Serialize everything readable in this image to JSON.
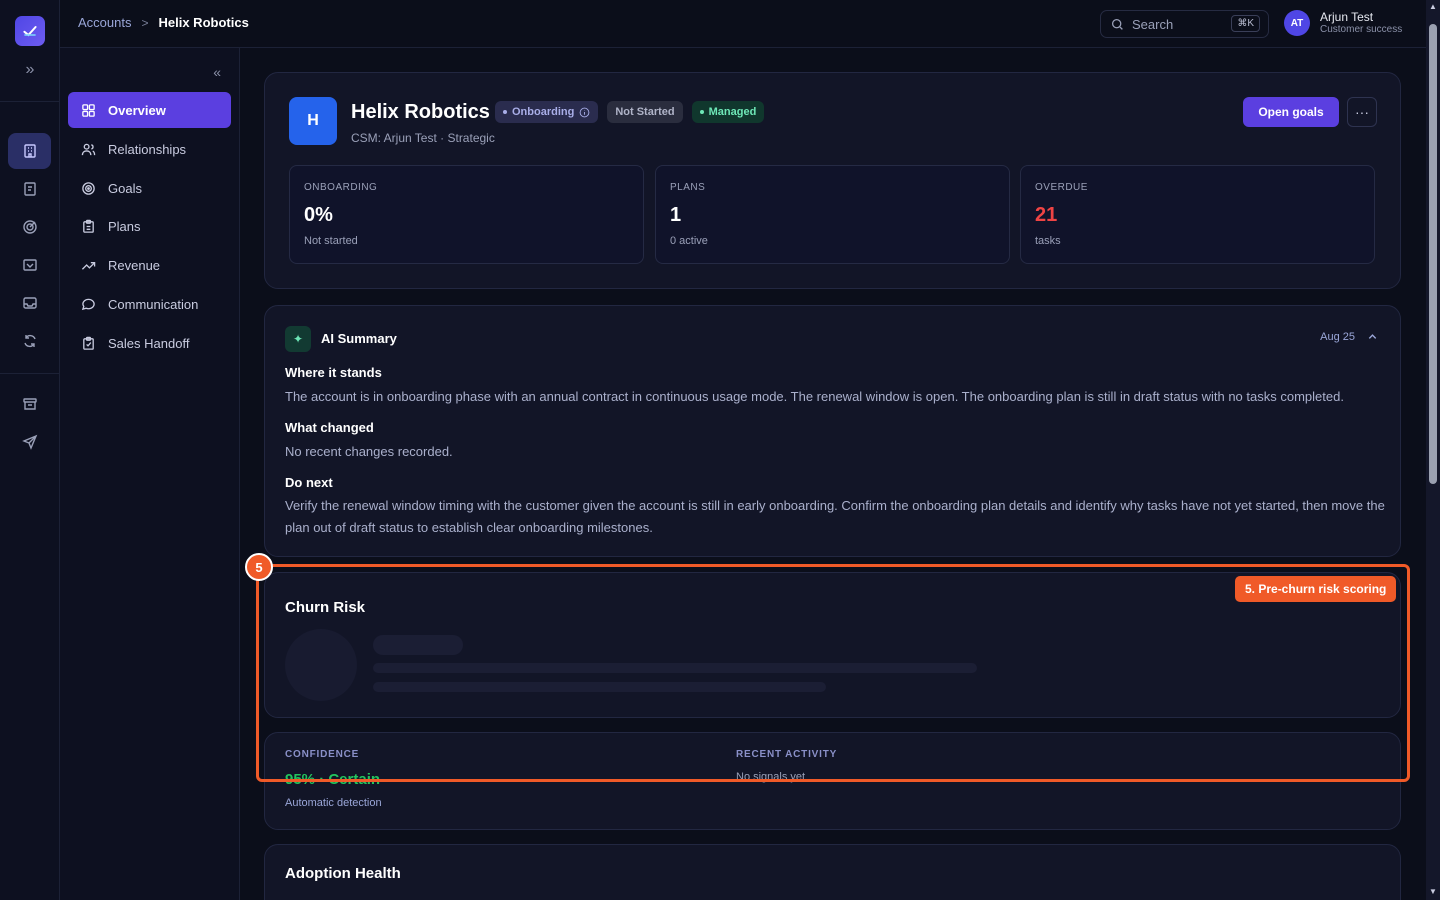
{
  "app": {
    "logo_icon": "check-logo-icon"
  },
  "breadcrumb": {
    "parent": "Accounts",
    "separator": ">",
    "current": "Helix Robotics"
  },
  "search": {
    "placeholder": "Search",
    "shortcut": "⌘K"
  },
  "user": {
    "initials": "AT",
    "name": "Arjun Test",
    "role": "Customer success"
  },
  "rail": {
    "icons": [
      "building-icon",
      "clipboard-icon",
      "target-icon",
      "handshake-icon",
      "inbox-icon",
      "refresh-icon",
      "archive-icon",
      "send-icon"
    ],
    "active": "building-icon"
  },
  "sidebar": {
    "items": [
      {
        "label": "Overview",
        "icon": "grid-icon",
        "active": true
      },
      {
        "label": "Relationships",
        "icon": "users-icon"
      },
      {
        "label": "Goals",
        "icon": "target-icon"
      },
      {
        "label": "Plans",
        "icon": "clipboard-icon"
      },
      {
        "label": "Revenue",
        "icon": "trend-up-icon"
      },
      {
        "label": "Communication",
        "icon": "chat-icon"
      },
      {
        "label": "Sales Handoff",
        "icon": "clipboard-check-icon"
      }
    ]
  },
  "account": {
    "initial": "H",
    "name": "Helix Robotics",
    "badges": {
      "phase": "Onboarding",
      "status": "Not Started",
      "type": "Managed"
    },
    "subtitle": "CSM: Arjun Test · Strategic",
    "primary_action": "Open goals",
    "more": "···"
  },
  "stats": [
    {
      "label": "ONBOARDING",
      "value": "0%",
      "sub": "Not started"
    },
    {
      "label": "PLANS",
      "value": "1",
      "sub": "0 active"
    },
    {
      "label": "OVERDUE",
      "value": "21",
      "sub": "tasks",
      "color": "#ef4444"
    }
  ],
  "ai_summary": {
    "title": "AI Summary",
    "date": "Aug 25",
    "sections": [
      {
        "heading": "Where it stands",
        "text": "The account is in onboarding phase with an annual contract in continuous usage mode. The renewal window is open. The onboarding plan is still in draft status with no tasks completed."
      },
      {
        "heading": "What changed",
        "text": "No recent changes recorded."
      },
      {
        "heading": "Do next",
        "text": "Verify the renewal window timing with the customer given the account is still in early onboarding. Confirm the onboarding plan details and identify why tasks have not yet started, then move the plan out of draft status to establish clear onboarding milestones."
      }
    ]
  },
  "churn_risk": {
    "title": "Churn Risk"
  },
  "confidence": {
    "label": "CONFIDENCE",
    "value": "95% · Certain",
    "sub": "Automatic detection",
    "recent_label": "RECENT ACTIVITY",
    "recent_value": "No signals yet"
  },
  "adoption": {
    "title": "Adoption Health"
  },
  "highlight": {
    "number": "5",
    "tag": "5. Pre-churn risk scoring",
    "color": "#f05a28"
  },
  "colors": {
    "accent": "#5b3fe0",
    "danger": "#ef4444",
    "success": "#22c55e",
    "background": "#0b0e1a"
  }
}
